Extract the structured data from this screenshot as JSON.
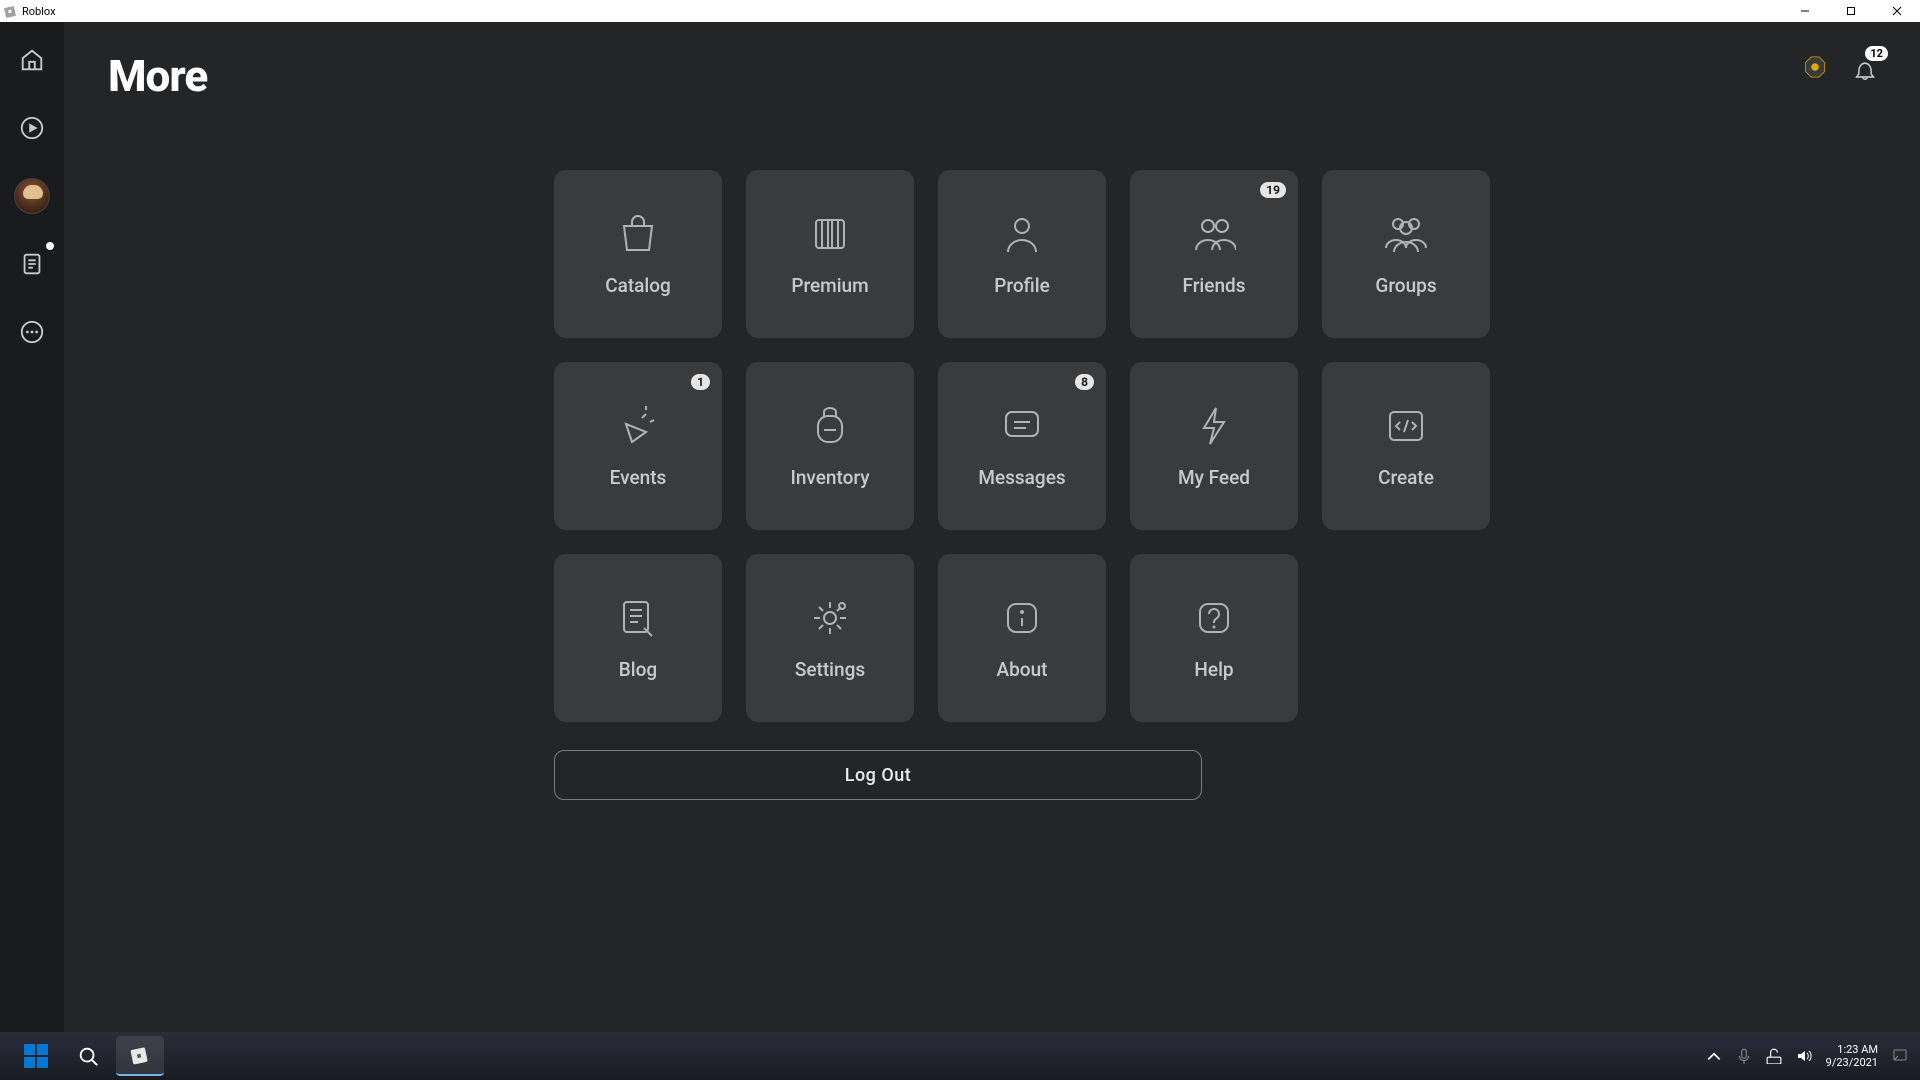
{
  "window": {
    "title": "Roblox"
  },
  "page": {
    "title": "More"
  },
  "topbar": {
    "notification_count": "12"
  },
  "sidebar": {
    "has_messages_dot": true
  },
  "tiles": [
    {
      "id": "catalog",
      "label": "Catalog",
      "icon": "bag",
      "badge": null
    },
    {
      "id": "premium",
      "label": "Premium",
      "icon": "premium",
      "badge": null
    },
    {
      "id": "profile",
      "label": "Profile",
      "icon": "person",
      "badge": null
    },
    {
      "id": "friends",
      "label": "Friends",
      "icon": "friends",
      "badge": "19"
    },
    {
      "id": "groups",
      "label": "Groups",
      "icon": "groups",
      "badge": null
    },
    {
      "id": "events",
      "label": "Events",
      "icon": "party",
      "badge": "1"
    },
    {
      "id": "inventory",
      "label": "Inventory",
      "icon": "backpack",
      "badge": null
    },
    {
      "id": "messages",
      "label": "Messages",
      "icon": "message",
      "badge": "8"
    },
    {
      "id": "myfeed",
      "label": "My Feed",
      "icon": "bolt",
      "badge": null
    },
    {
      "id": "create",
      "label": "Create",
      "icon": "code",
      "badge": null
    },
    {
      "id": "blog",
      "label": "Blog",
      "icon": "blog",
      "badge": null
    },
    {
      "id": "settings",
      "label": "Settings",
      "icon": "gear",
      "badge": null
    },
    {
      "id": "about",
      "label": "About",
      "icon": "info",
      "badge": null
    },
    {
      "id": "help",
      "label": "Help",
      "icon": "question",
      "badge": null
    }
  ],
  "logout": {
    "label": "Log Out"
  },
  "taskbar": {
    "time": "1:23 AM",
    "date": "9/23/2021"
  }
}
